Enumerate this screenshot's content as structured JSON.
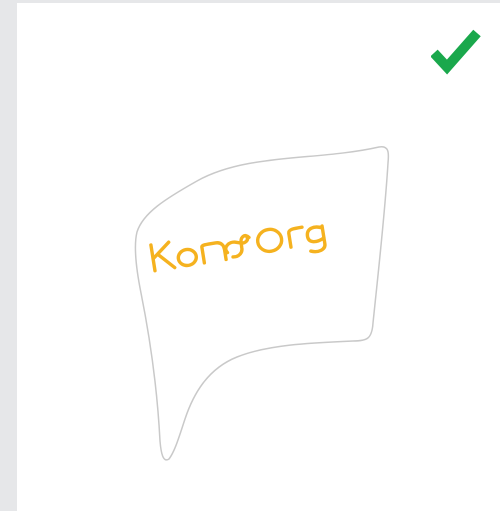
{
  "app": {
    "background": "#e6e7e9",
    "card_background": "#ffffff"
  },
  "status": {
    "icon": "checkmark-icon",
    "color": "#1aa84c",
    "selected": true
  },
  "flag": {
    "logo_text": "Kon Org",
    "logo_color": "#f5b21f",
    "outline_color": "#c9c9c9"
  }
}
